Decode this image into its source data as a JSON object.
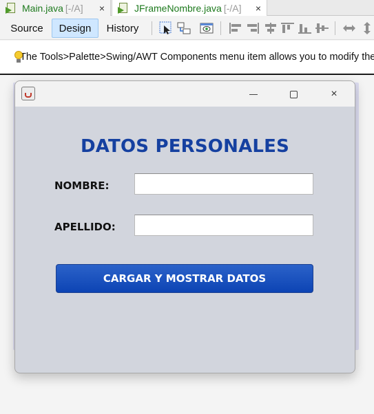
{
  "editor_tabs": [
    {
      "name": "Main.java",
      "flag": "[-/A]",
      "close": "×"
    },
    {
      "name": "JFrameNombre.java",
      "flag": "[-/A]",
      "close": "×"
    }
  ],
  "toolbar": {
    "modes": [
      "Source",
      "Design",
      "History"
    ],
    "active_mode": "Design"
  },
  "hint": {
    "text": "The Tools>Palette>Swing/AWT Components menu item allows you to modify the palette"
  },
  "jframe": {
    "heading": "DATOS PERSONALES",
    "fields": [
      {
        "label": "NOMBRE:",
        "value": ""
      },
      {
        "label": "APELLIDO:",
        "value": ""
      }
    ],
    "button_label": "CARGAR Y MOSTRAR DATOS",
    "window_controls": {
      "close": "×"
    }
  },
  "colors": {
    "heading": "#1540a0",
    "button": "#1a50bd",
    "form_background": "#d2d5dd",
    "tab_name": "#1e7a1e",
    "active_mode_bg": "#cfe7ff"
  }
}
